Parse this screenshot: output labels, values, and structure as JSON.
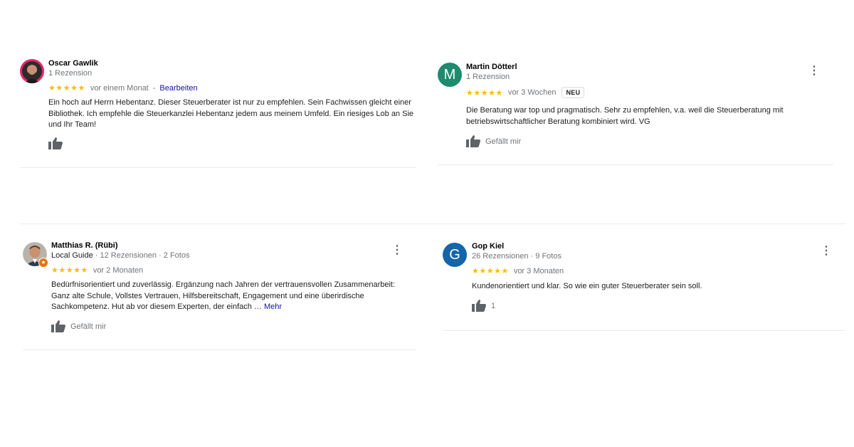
{
  "reviews": [
    {
      "name": "Oscar Gawlik",
      "meta": "1 Rezension",
      "stars": "★★★★★",
      "time": "vor einem Monat",
      "separator": "-",
      "edit_label": "Bearbeiten",
      "text": "Ein hoch auf Herrn Hebentanz. Dieser Steuerberater ist nur zu empfehlen. Sein Fachwissen gleicht einer Bibliothek. Ich empfehle die Steuerkanzlei Hebentanz jedem aus meinem Umfeld. Ein riesiges Lob an Sie und Ihr Team!",
      "like_icon": "thumb-up-icon"
    },
    {
      "name": "Martin Dötterl",
      "avatar_letter": "M",
      "avatar_color": "#1e8a6e",
      "meta": "1 Rezension",
      "stars": "★★★★★",
      "time": "vor 3 Wochen",
      "badge": "NEU",
      "text": "Die Beratung war top und pragmatisch. Sehr zu empfehlen, v.a. weil die Steuerberatung mit betriebswirtschaftlicher Beratung kombiniert wird. VG",
      "like_label": "Gefällt mir",
      "menu_icon": "⋮"
    },
    {
      "name": "Matthias R. (Rübi)",
      "meta_guide": "Local Guide",
      "meta_rest": " · 12 Rezensionen · 2 Fotos",
      "stars": "★★★★★",
      "time": "vor 2 Monaten",
      "text": "Bedürfnisorientiert und zuverlässig. Ergänzung nach Jahren der vertrauensvollen Zusammenarbeit: Ganz alte Schule, Vollstes Vertrauen, Hilfsbereitschaft, Engagement und eine überirdische Sachkompetenz. Hut ab vor diesem Experten, der einfach …",
      "more_label": "Mehr",
      "like_label": "Gefällt mir",
      "menu_icon": "⋮"
    },
    {
      "name": "Gop Kiel",
      "avatar_letter": "G",
      "avatar_color": "#1565a8",
      "meta": "26 Rezensionen · 9 Fotos",
      "stars": "★★★★★",
      "time": "vor 3 Monaten",
      "text": "Kundenorientiert und klar. So wie ein guter Steuerberater sein soll.",
      "like_count": "1",
      "menu_icon": "⋮"
    }
  ],
  "colors": {
    "star": "#fbbc04",
    "link": "#1a0dab",
    "muted": "#70757a",
    "guide_badge": "#e8710a"
  }
}
